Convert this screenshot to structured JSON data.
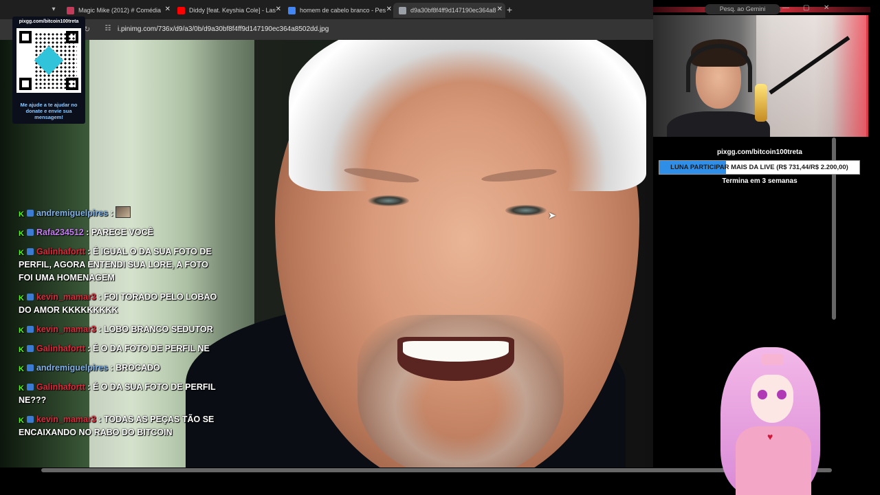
{
  "browser": {
    "tabs": [
      {
        "title": "Magic Mike (2012) # Comédia",
        "favicon_color": "#c43a5a"
      },
      {
        "title": "Diddy [feat. Keyshia Cole] - Las",
        "favicon_color": "#ff0000"
      },
      {
        "title": "homem de cabelo branco - Pes",
        "favicon_color": "#4285f4"
      },
      {
        "title": "d9a30bf8f4ff9d147190ec364a8",
        "favicon_color": "#9aa0a6"
      }
    ],
    "url": "i.pinimg.com/736x/d9/a3/0b/d9a30bf8f4ff9d147190ec364a8502dd.jpg",
    "gemini_label": "Pesq. ao Gemini",
    "newtab_icon": "+",
    "reload_icon": "↻"
  },
  "donation": {
    "url": "pixgg.com/bitcoin100treta",
    "message": "Me ajude a te ajudar no donate e envie sua mensagem!"
  },
  "chat": [
    {
      "user": "andremiguelpires",
      "color": "#7fb2e8",
      "text": "",
      "emote": true
    },
    {
      "user": "Rafa234512",
      "color": "#c47df0",
      "text": "PARECE VOCÊ"
    },
    {
      "user": "Galinhafortt",
      "color": "#e0283a",
      "text": "É IGUAL O DA SUA FOTO DE PERFIL, AGORA ENTENDI SUA LORE, A FOTO FOI UMA HOMENAGEM"
    },
    {
      "user": "kevin_mamar3",
      "color": "#e0283a",
      "text": "FOI TORADO PELO LOBAO DO AMOR KKKKKKKKK"
    },
    {
      "user": "kevin_mamar3",
      "color": "#e0283a",
      "text": "LOBO BRANCO SEDUTOR"
    },
    {
      "user": "Galinhafortt",
      "color": "#e0283a",
      "text": "É O DA FOTO DE PERFIL NE"
    },
    {
      "user": "andremiguelpires",
      "color": "#7fb2e8",
      "text": "BROCADO"
    },
    {
      "user": "Galinhafortt",
      "color": "#e0283a",
      "text": "É O DA SUA FOTO DE PERFIL NE???"
    },
    {
      "user": "kevin_mamar3",
      "color": "#e0283a",
      "text": "TODAS AS PEÇAS TÃO SE ENCAIXANDO NO RABO DO BITCOIN"
    }
  ],
  "goal": {
    "url": "pixgg.com/bitcoin100treta",
    "label": "LUNA PARTICIPAR MAIS DA LIVE (R$ 731,44/R$ 2.200,00)",
    "current": 731.44,
    "target": 2200.0,
    "ends": "Termina em 3 semanas",
    "fill_color": "#2f8fe8"
  }
}
